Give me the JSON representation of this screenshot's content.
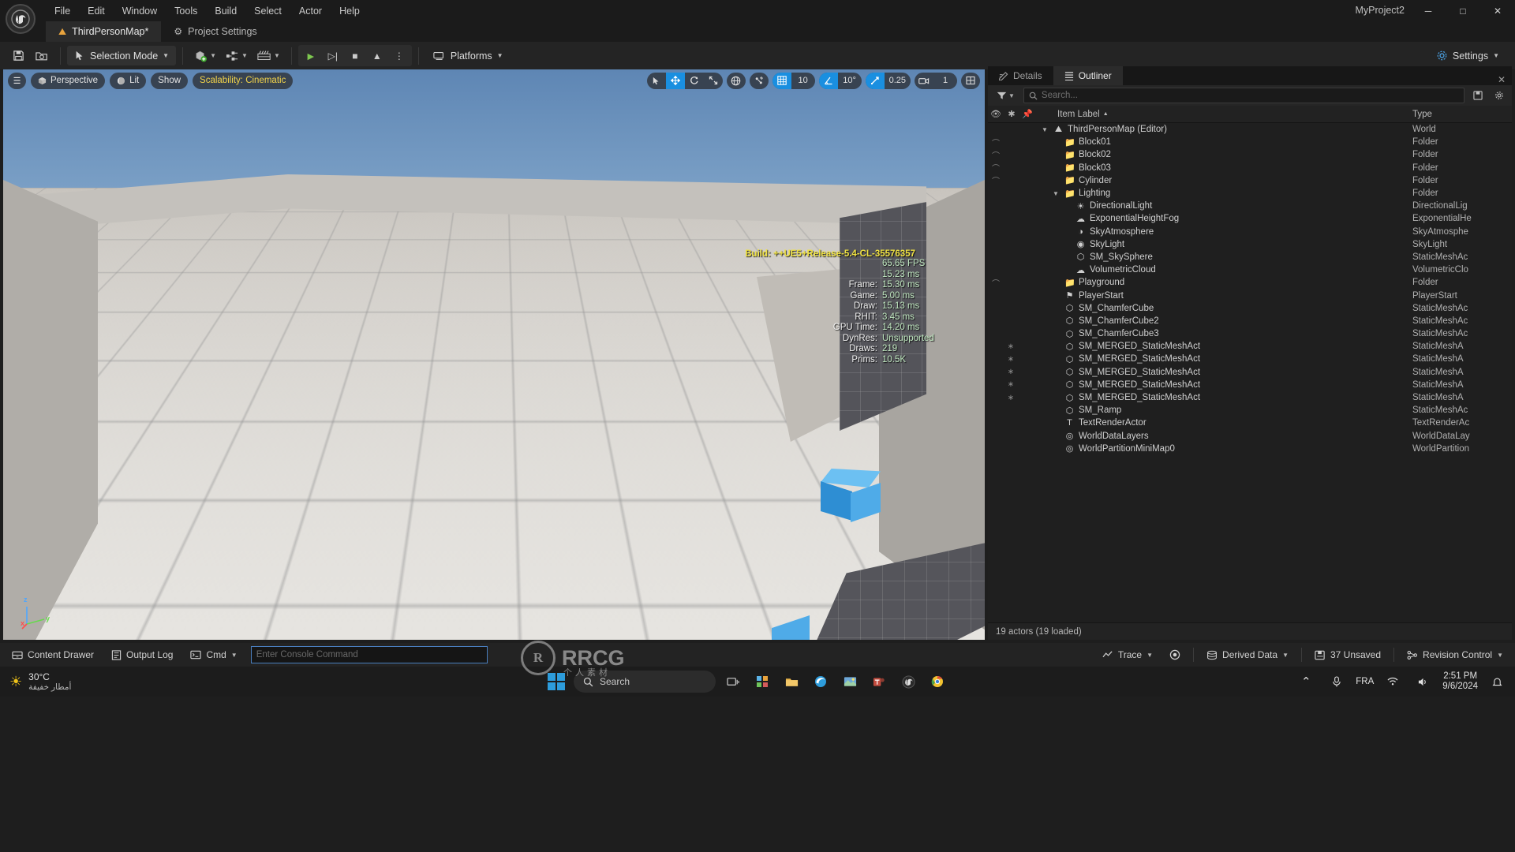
{
  "window": {
    "project_title": "MyProject2",
    "minimize": "─",
    "maximize": "□",
    "close": "✕"
  },
  "menu": {
    "items": [
      {
        "label": "File"
      },
      {
        "label": "Edit"
      },
      {
        "label": "Window"
      },
      {
        "label": "Tools"
      },
      {
        "label": "Build"
      },
      {
        "label": "Select"
      },
      {
        "label": "Actor"
      },
      {
        "label": "Help"
      }
    ]
  },
  "tabs": [
    {
      "label": "ThirdPersonMap*",
      "icon": "level-icon",
      "glyph": "⛰",
      "active": true
    },
    {
      "label": "Project Settings",
      "icon": "project-settings-icon",
      "glyph": "⚙",
      "active": false
    }
  ],
  "toolbar": {
    "save_icon": "save-icon",
    "save_glyph": "💾",
    "browse_icon": "browse-icon",
    "browse_glyph": "🗁",
    "mode_label": "Selection Mode",
    "mode_icon": "cursor-select-icon",
    "add_icon": "add-actor-icon",
    "blueprints_icon": "blueprints-icon",
    "cinematics_icon": "cinematics-icon",
    "play_icon": "play-icon",
    "skip_icon": "step-icon",
    "stop_icon": "stop-icon",
    "eject_icon": "eject-icon",
    "more_icon": "more-options-icon",
    "platforms_label": "Platforms",
    "platforms_icon": "platforms-icon",
    "settings_label": "Settings",
    "settings_icon": "gear-icon"
  },
  "viewport": {
    "menu_icon": "viewport-menu-icon",
    "camera_label": "Perspective",
    "camera_icon": "cube-icon",
    "viewmode_label": "Lit",
    "viewmode_icon": "sphere-icon",
    "show_label": "Show",
    "scalability_label": "Scalability: Cinematic",
    "gizmos": {
      "select": "➤",
      "move": "✥",
      "rotate": "↻",
      "scale": "⤡",
      "active": "move"
    },
    "coord_icon": "world-coordinate-icon",
    "surface_snap_icon": "surface-snap-icon",
    "grid_snap_icon": "grid-snap-icon",
    "grid_snap_value": "10",
    "angle_snap_icon": "angle-snap-icon",
    "angle_snap_value": "10°",
    "scale_snap_icon": "scale-snap-icon",
    "scale_snap_value": "0.25",
    "camera_speed_icon": "camera-speed-icon",
    "camera_speed_value": "1",
    "layout_icon": "viewport-layout-icon",
    "build_string": "Build: ++UE5+Release-5.4-CL-35576357",
    "axis_x": "x",
    "axis_y": "y",
    "axis_z": "z"
  },
  "stats": [
    {
      "label": "",
      "value": "65.65 FPS"
    },
    {
      "label": "",
      "value": "15.23 ms"
    },
    {
      "label": "Frame:",
      "value": "15.30 ms"
    },
    {
      "label": "Game:",
      "value": "5.00 ms"
    },
    {
      "label": "Draw:",
      "value": "15.13 ms"
    },
    {
      "label": "RHIT:",
      "value": "3.45 ms"
    },
    {
      "label": "GPU Time:",
      "value": "14.20 ms"
    },
    {
      "label": "DynRes:",
      "value": "Unsupported"
    },
    {
      "label": "Draws:",
      "value": "219"
    },
    {
      "label": "Prims:",
      "value": "10.5K"
    }
  ],
  "right_panel": {
    "tabs": [
      {
        "label": "Details",
        "icon": "details-icon",
        "glyph": "✎",
        "active": false
      },
      {
        "label": "Outliner",
        "icon": "outliner-icon",
        "glyph": "☰",
        "active": true
      }
    ],
    "close_glyph": "✕",
    "filter_icon": "filter-icon",
    "search_icon": "search-icon",
    "search_placeholder": "Search...",
    "settings_icon": "outliner-settings-icon",
    "save_icon": "outliner-save-icon",
    "columns": {
      "visibility_icon": "eye-icon",
      "favorite_icon": "star-icon",
      "pin_icon": "pin-icon",
      "item_label": "Item Label",
      "sort_glyph": "▲",
      "type": "Type"
    },
    "rows": [
      {
        "indent": 1,
        "twisty": "▼",
        "icon": "world-icon",
        "glyph": "⛰",
        "label": "ThirdPersonMap (Editor)",
        "type": "World",
        "eye": false,
        "star": false
      },
      {
        "indent": 2,
        "twisty": "",
        "icon": "folder-icon",
        "glyph": "📁",
        "label": "Block01",
        "type": "Folder",
        "eye": true,
        "star": false
      },
      {
        "indent": 2,
        "twisty": "",
        "icon": "folder-icon",
        "glyph": "📁",
        "label": "Block02",
        "type": "Folder",
        "eye": true,
        "star": false
      },
      {
        "indent": 2,
        "twisty": "",
        "icon": "folder-icon",
        "glyph": "📁",
        "label": "Block03",
        "type": "Folder",
        "eye": true,
        "star": false
      },
      {
        "indent": 2,
        "twisty": "",
        "icon": "folder-icon",
        "glyph": "📁",
        "label": "Cylinder",
        "type": "Folder",
        "eye": true,
        "star": false
      },
      {
        "indent": 2,
        "twisty": "▼",
        "icon": "folder-icon",
        "glyph": "📁",
        "label": "Lighting",
        "type": "Folder",
        "eye": false,
        "star": false
      },
      {
        "indent": 3,
        "twisty": "",
        "icon": "directional-light-icon",
        "glyph": "☀",
        "label": "DirectionalLight",
        "type": "DirectionalLig",
        "eye": false,
        "star": false
      },
      {
        "indent": 3,
        "twisty": "",
        "icon": "fog-icon",
        "glyph": "☁",
        "label": "ExponentialHeightFog",
        "type": "ExponentialHe",
        "eye": false,
        "star": false
      },
      {
        "indent": 3,
        "twisty": "",
        "icon": "sky-atmosphere-icon",
        "glyph": "◑",
        "label": "SkyAtmosphere",
        "type": "SkyAtmosphe",
        "eye": false,
        "star": false
      },
      {
        "indent": 3,
        "twisty": "",
        "icon": "sky-light-icon",
        "glyph": "◉",
        "label": "SkyLight",
        "type": "SkyLight",
        "eye": false,
        "star": false
      },
      {
        "indent": 3,
        "twisty": "",
        "icon": "static-mesh-icon",
        "glyph": "⬡",
        "label": "SM_SkySphere",
        "type": "StaticMeshAc",
        "eye": false,
        "star": false
      },
      {
        "indent": 3,
        "twisty": "",
        "icon": "volumetric-cloud-icon",
        "glyph": "☁",
        "label": "VolumetricCloud",
        "type": "VolumetricClo",
        "eye": false,
        "star": false
      },
      {
        "indent": 2,
        "twisty": "",
        "icon": "folder-icon",
        "glyph": "📁",
        "label": "Playground",
        "type": "Folder",
        "eye": true,
        "star": false
      },
      {
        "indent": 2,
        "twisty": "",
        "icon": "player-start-icon",
        "glyph": "⚑",
        "label": "PlayerStart",
        "type": "PlayerStart",
        "eye": false,
        "star": false
      },
      {
        "indent": 2,
        "twisty": "",
        "icon": "static-mesh-icon",
        "glyph": "⬡",
        "label": "SM_ChamferCube",
        "type": "StaticMeshAc",
        "eye": false,
        "star": false
      },
      {
        "indent": 2,
        "twisty": "",
        "icon": "static-mesh-icon",
        "glyph": "⬡",
        "label": "SM_ChamferCube2",
        "type": "StaticMeshAc",
        "eye": false,
        "star": false
      },
      {
        "indent": 2,
        "twisty": "",
        "icon": "static-mesh-icon",
        "glyph": "⬡",
        "label": "SM_ChamferCube3",
        "type": "StaticMeshAc",
        "eye": false,
        "star": false
      },
      {
        "indent": 2,
        "twisty": "",
        "icon": "static-mesh-icon",
        "glyph": "⬡",
        "label": "SM_MERGED_StaticMeshAct",
        "type": "StaticMeshA",
        "eye": false,
        "star": true
      },
      {
        "indent": 2,
        "twisty": "",
        "icon": "static-mesh-icon",
        "glyph": "⬡",
        "label": "SM_MERGED_StaticMeshAct",
        "type": "StaticMeshA",
        "eye": false,
        "star": true
      },
      {
        "indent": 2,
        "twisty": "",
        "icon": "static-mesh-icon",
        "glyph": "⬡",
        "label": "SM_MERGED_StaticMeshAct",
        "type": "StaticMeshA",
        "eye": false,
        "star": true
      },
      {
        "indent": 2,
        "twisty": "",
        "icon": "static-mesh-icon",
        "glyph": "⬡",
        "label": "SM_MERGED_StaticMeshAct",
        "type": "StaticMeshA",
        "eye": false,
        "star": true
      },
      {
        "indent": 2,
        "twisty": "",
        "icon": "static-mesh-icon",
        "glyph": "⬡",
        "label": "SM_MERGED_StaticMeshAct",
        "type": "StaticMeshA",
        "eye": false,
        "star": true
      },
      {
        "indent": 2,
        "twisty": "",
        "icon": "static-mesh-icon",
        "glyph": "⬡",
        "label": "SM_Ramp",
        "type": "StaticMeshAc",
        "eye": false,
        "star": false
      },
      {
        "indent": 2,
        "twisty": "",
        "icon": "text-render-icon",
        "glyph": "T",
        "label": "TextRenderActor",
        "type": "TextRenderAc",
        "eye": false,
        "star": false
      },
      {
        "indent": 2,
        "twisty": "",
        "icon": "data-layers-icon",
        "glyph": "◎",
        "label": "WorldDataLayers",
        "type": "WorldDataLay",
        "eye": false,
        "star": false
      },
      {
        "indent": 2,
        "twisty": "",
        "icon": "minimap-icon",
        "glyph": "◎",
        "label": "WorldPartitionMiniMap0",
        "type": "WorldPartition",
        "eye": false,
        "star": false
      }
    ],
    "footer": "19 actors (19 loaded)"
  },
  "bottom_bar": {
    "content_drawer": "Content Drawer",
    "content_drawer_icon": "drawer-icon",
    "output_log": "Output Log",
    "output_log_icon": "log-icon",
    "cmd_label": "Cmd",
    "cmd_icon": "console-icon",
    "console_placeholder": "Enter Console Command",
    "trace_label": "Trace",
    "trace_icon": "trace-icon",
    "record_icon": "record-icon",
    "derived_data_label": "Derived Data",
    "derived_data_icon": "derived-data-icon",
    "unsaved_label": "37 Unsaved",
    "unsaved_icon": "unsaved-icon",
    "revision_label": "Revision Control",
    "revision_icon": "revision-control-icon"
  },
  "watermark": {
    "mark": "R",
    "text": "RRCG",
    "subtext": "个人素材"
  },
  "taskbar": {
    "weather_temp": "30°C",
    "weather_desc": "أمطار خفيفة",
    "weather_icon": "weather-icon",
    "start_icon": "windows-start-icon",
    "search_text": "Search",
    "search_icon": "search-icon",
    "apps": [
      {
        "icon": "task-view-icon",
        "glyph": "▭"
      },
      {
        "icon": "widgets-icon",
        "glyph": "◰"
      },
      {
        "icon": "explorer-icon",
        "glyph": "📁"
      },
      {
        "icon": "edge-icon",
        "glyph": "◕"
      },
      {
        "icon": "photos-icon",
        "glyph": "🖼"
      },
      {
        "icon": "teams-icon",
        "glyph": "▣"
      },
      {
        "icon": "unreal-icon",
        "glyph": "ⓤ"
      },
      {
        "icon": "chrome-icon",
        "glyph": "●"
      }
    ],
    "chevron": "⌃",
    "mic_icon": "microphone-icon",
    "lang": "FRA",
    "network_icon": "network-icon",
    "volume_icon": "volume-icon",
    "time": "2:51 PM",
    "date": "9/6/2024",
    "notify_icon": "notification-icon"
  },
  "colors": {
    "accent": "#1a8fe0",
    "warn": "#f2d34a",
    "cube": "#4aa8e6",
    "folder": "#d9b45a"
  }
}
